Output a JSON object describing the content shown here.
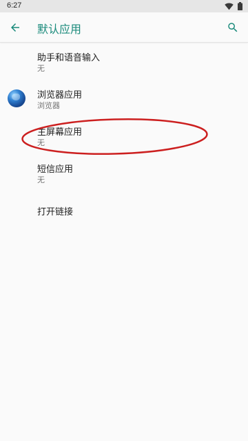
{
  "status_bar": {
    "time": "6:27"
  },
  "app_bar": {
    "title": "默认应用",
    "back_icon": "arrow-back-icon",
    "search_icon": "search-icon"
  },
  "list": {
    "items": [
      {
        "title": "助手和语音输入",
        "summary": "无"
      },
      {
        "title": "浏览器应用",
        "summary": "浏览器",
        "icon": "browser-globe-icon"
      },
      {
        "title": "主屏幕应用",
        "summary": "无"
      },
      {
        "title": "短信应用",
        "summary": "无"
      },
      {
        "title": "打开链接"
      }
    ]
  },
  "colors": {
    "accent": "#1a8a7b",
    "annotation": "#cc1f1f"
  }
}
